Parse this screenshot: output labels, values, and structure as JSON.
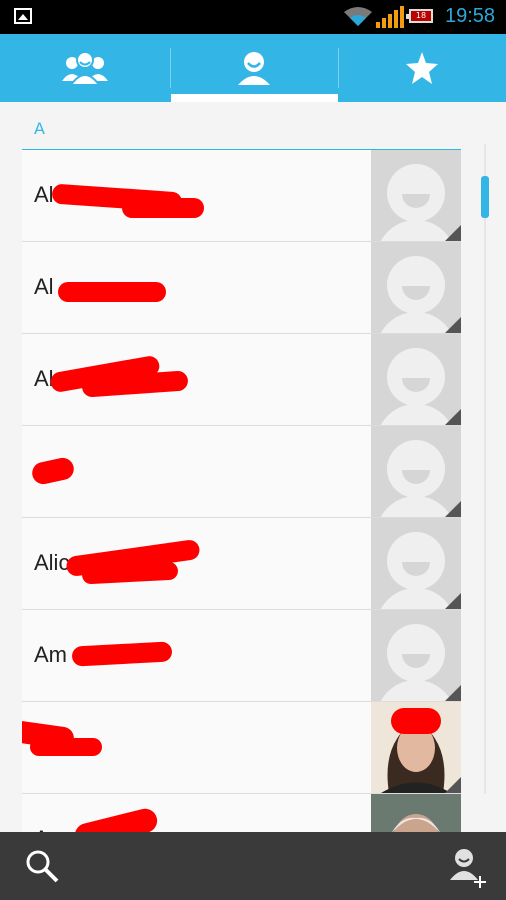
{
  "status_bar": {
    "time": "19:58",
    "battery_level": "18",
    "icons": [
      "gallery-icon",
      "wifi-icon",
      "signal-icon",
      "battery-icon"
    ]
  },
  "tabs": [
    {
      "name": "groups",
      "icon": "groups-icon"
    },
    {
      "name": "contacts",
      "icon": "person-icon",
      "selected": true
    },
    {
      "name": "favorites",
      "icon": "star-icon"
    }
  ],
  "section_letter": "A",
  "contacts": [
    {
      "name": "Al",
      "photo": "placeholder"
    },
    {
      "name": "Al",
      "photo": "placeholder"
    },
    {
      "name": "Al",
      "photo": "placeholder"
    },
    {
      "name": "",
      "photo": "placeholder"
    },
    {
      "name": "Alic",
      "photo": "placeholder"
    },
    {
      "name": "Am",
      "photo": "placeholder"
    },
    {
      "name": "",
      "photo": "photo-woman"
    },
    {
      "name": "A",
      "photo": "photo-man"
    }
  ],
  "bottom_bar": {
    "icons": [
      "search-icon",
      "add-contact-icon"
    ]
  },
  "colors": {
    "accent": "#33b5e5",
    "redaction": "#ff0000",
    "bottom_bar": "#3a3a3a"
  }
}
